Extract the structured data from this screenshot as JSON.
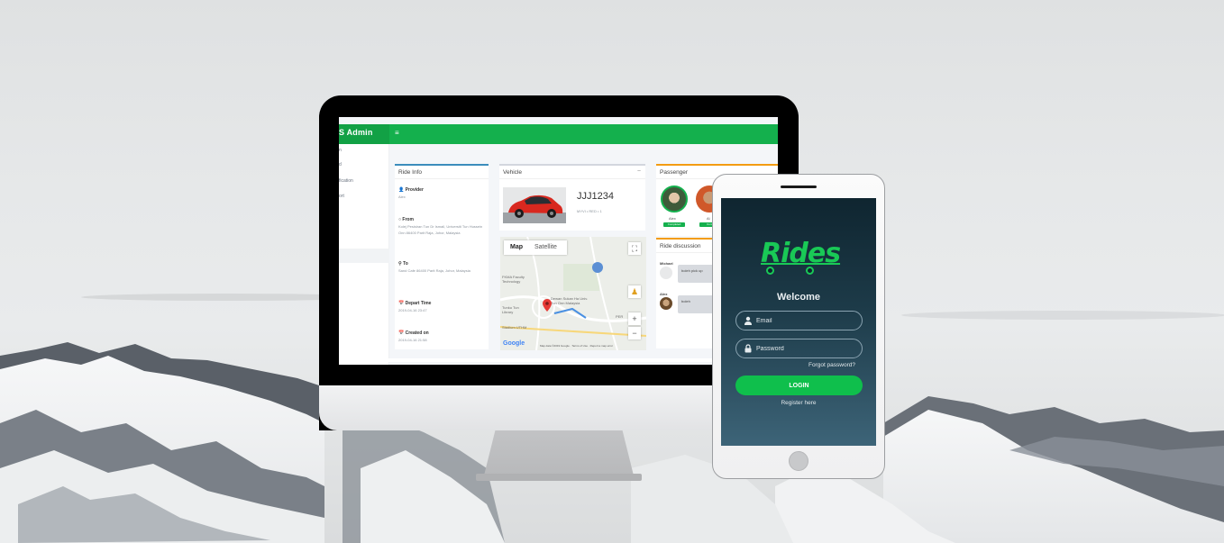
{
  "admin": {
    "brand": "S Admin",
    "menu_icon": "≡",
    "sidebar_items": [
      "n",
      "d",
      "fication",
      "ort"
    ],
    "ride_info": {
      "title": "Ride Info",
      "provider_label": "Provider",
      "provider_value": "Alex",
      "from_label": "From",
      "from_value": "Kolej Pesisiran Tun Dr Ismail, Universiti Tun Hussein Onn 86400 Parit Raja, Johor, Malaysia",
      "to_label": "To",
      "to_value": "Sand Cafe 86400 Parit Raja, Johor, Malaysia",
      "depart_label": "Depart Time",
      "depart_value": "2019-04-16 23:47",
      "created_label": "Created on",
      "created_value": "2019-04-16 21:58"
    },
    "vehicle": {
      "title": "Vehicle",
      "collapse": "−",
      "plate": "JJJ1234",
      "details": "MYVI • RED • 1"
    },
    "map": {
      "tab_map": "Map",
      "tab_satellite": "Satellite",
      "zoom_in": "+",
      "zoom_out": "−",
      "labels": [
        "FKMA Faculty Technology",
        "Tunku Tun Library",
        "Dewan Sukan Ha Univ. Tun Onn Malaysia",
        "PER",
        "Stadium UTHM"
      ],
      "google": "Google",
      "footer": "Map data ©2019 Google · Terms of Use · Report a map error"
    },
    "passenger": {
      "title": "Passenger",
      "names": [
        "Alex",
        "Al"
      ],
      "status": [
        "Completed",
        "Comp"
      ]
    },
    "discussion": {
      "title": "Ride discussion",
      "messages": [
        {
          "author": "Michael",
          "text": "boleh pick up"
        },
        {
          "author": "Alex",
          "text": "boleh"
        }
      ]
    }
  },
  "phone": {
    "logo": "Rides",
    "welcome": "Welcome",
    "email_placeholder": "Email",
    "password_placeholder": "Password",
    "forgot": "Forgot password?",
    "login": "LOGIN",
    "register": "Register here"
  },
  "colors": {
    "accent_green": "#14b04d",
    "phone_gradient_top": "#0f2530",
    "phone_gradient_bottom": "#3d6478",
    "logo_green": "#19c956"
  }
}
